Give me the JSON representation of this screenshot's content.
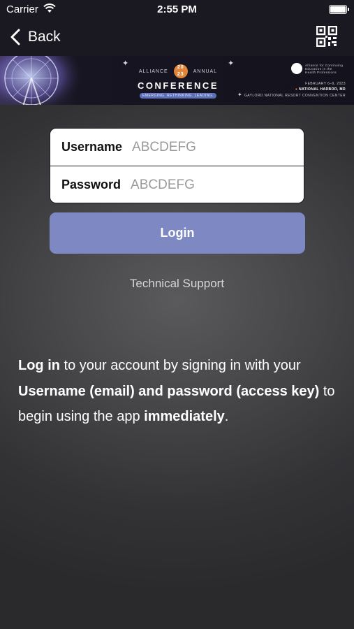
{
  "status_bar": {
    "carrier": "Carrier",
    "time": "2:55 PM"
  },
  "nav": {
    "back_label": "Back",
    "right_icon": "qr-code-icon"
  },
  "banner": {
    "org_small_left": "ALLIANCE",
    "year": "20\n23",
    "org_small_right": "ANNUAL",
    "title": "CONFERENCE",
    "tagline": "EMERGING. RETHINKING. LEADING.",
    "org_name": "Alliance for Continuing Education in the Health Professions",
    "dates": "FEBRUARY 6–9, 2023",
    "location": "NATIONAL HARBOR, MD",
    "venue": "GAYLORD NATIONAL RESORT CONVENTION CENTER"
  },
  "form": {
    "username_label": "Username",
    "username_placeholder": "ABCDEFG",
    "password_label": "Password",
    "password_placeholder": "ABCDEFG",
    "login_label": "Login"
  },
  "support_link": "Technical Support",
  "info": {
    "bold_1": "Log in",
    "text_1": " to your account by signing in with your ",
    "bold_2": "Username (email) and password (access key)",
    "text_2": " to begin using the app ",
    "bold_3": "immediately",
    "text_3": "."
  },
  "colors": {
    "login_button": "#7e89c4",
    "bar_bg": "#1a1820",
    "accent_orange": "#e0863b"
  }
}
